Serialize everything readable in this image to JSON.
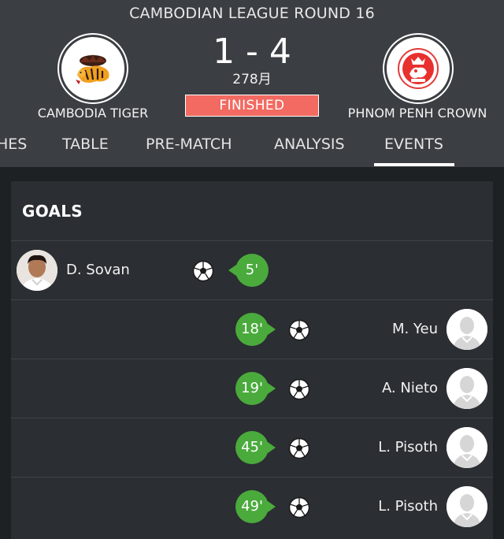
{
  "match": {
    "league": "CAMBODIAN LEAGUE ROUND 16",
    "score": "1 - 4",
    "date": "278月",
    "status": "FINISHED",
    "status_color": "#f26a61",
    "home": {
      "name": "CAMBODIA TIGER",
      "crest_icon": "tiger-crest-icon"
    },
    "away": {
      "name": "PHNOM PENH CROWN",
      "crest_icon": "crown-crest-icon"
    }
  },
  "tabs": [
    {
      "label": "HES"
    },
    {
      "label": "TABLE"
    },
    {
      "label": "PRE-MATCH"
    },
    {
      "label": "ANALYSIS"
    },
    {
      "label": "EVENTS",
      "active": true
    }
  ],
  "goals": {
    "title": "GOALS",
    "accent": "#4aaa3c",
    "events": [
      {
        "side": "home",
        "player": "D. Sovan",
        "minute": "5'"
      },
      {
        "side": "away",
        "player": "M. Yeu",
        "minute": "18'"
      },
      {
        "side": "away",
        "player": "A. Nieto",
        "minute": "19'"
      },
      {
        "side": "away",
        "player": "L. Pisoth",
        "minute": "45'"
      },
      {
        "side": "away",
        "player": "L. Pisoth",
        "minute": "49'"
      }
    ]
  }
}
